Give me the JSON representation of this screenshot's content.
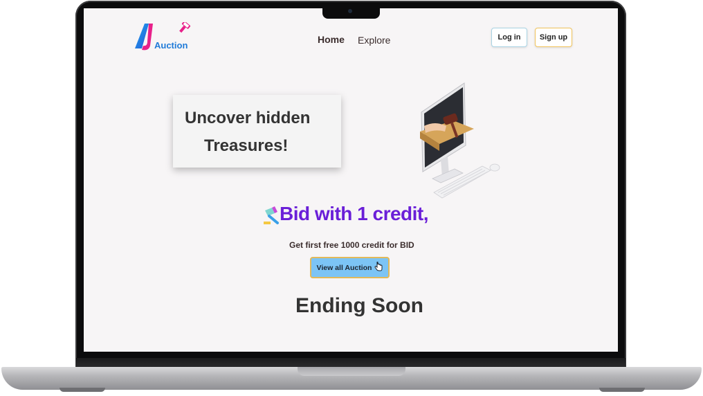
{
  "header": {
    "logo_text": "Auction",
    "nav": {
      "home": "Home",
      "explore": "Explore"
    },
    "login_label": "Log in",
    "signup_label": "Sign up"
  },
  "hero": {
    "line1": "Uncover hidden",
    "line2": "Treasures!"
  },
  "bid": {
    "headline": "Bid with 1 credit,",
    "subtext": "Get first free 1000 credit for BID",
    "view_all_label": "View all Auction"
  },
  "section": {
    "ending_title": "Ending Soon"
  },
  "icons": {
    "logo": "auction-logo-icon",
    "gavel_logo": "gavel-icon",
    "bid": "gavel-icon",
    "view_all": "pointer-hand-icon",
    "illustration": "computer-auction-illustration"
  },
  "colors": {
    "accent_purple": "#6a1fd8",
    "button_blue": "#7cc4f5",
    "button_border_gold": "#e2b95a",
    "logo_blue": "#1f7ad8",
    "logo_pink": "#e8208a"
  }
}
